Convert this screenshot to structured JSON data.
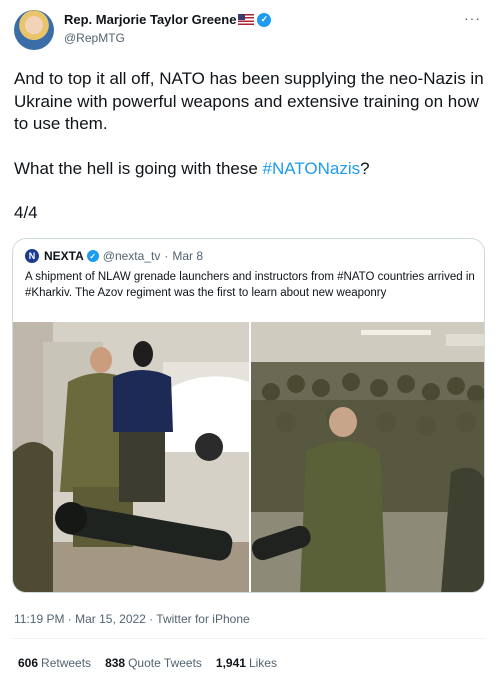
{
  "author": {
    "name": "Rep. Marjorie Taylor Greene",
    "handle": "@RepMTG"
  },
  "more_label": "···",
  "tweet": {
    "line1": "And to top it all off, NATO has been supplying the neo-Nazis in Ukraine with powerful weapons and extensive training on how to use them.",
    "line2_prefix": "What the hell is going with these ",
    "hashtag": "#NATONazis",
    "line2_suffix": "?",
    "counter": "4/4"
  },
  "quote": {
    "logo_letter": "N",
    "name": "NEXTA",
    "handle": "@nexta_tv",
    "separator": "·",
    "date": "Mar 8",
    "text": "A shipment of NLAW grenade launchers and instructors from #NATO countries arrived in #Kharkiv. The Azov regiment was the first to learn about new weaponry"
  },
  "meta": {
    "time": "11:19 PM · Mar 15, 2022 · Twitter for iPhone"
  },
  "stats": {
    "retweets_count": "606",
    "retweets_label": "Retweets",
    "quotes_count": "838",
    "quotes_label": "Quote Tweets",
    "likes_count": "1,941",
    "likes_label": "Likes"
  },
  "colors": {
    "accent": "#1d9bf0",
    "muted": "#536471",
    "text": "#0f1419",
    "border": "#cfd9de"
  }
}
